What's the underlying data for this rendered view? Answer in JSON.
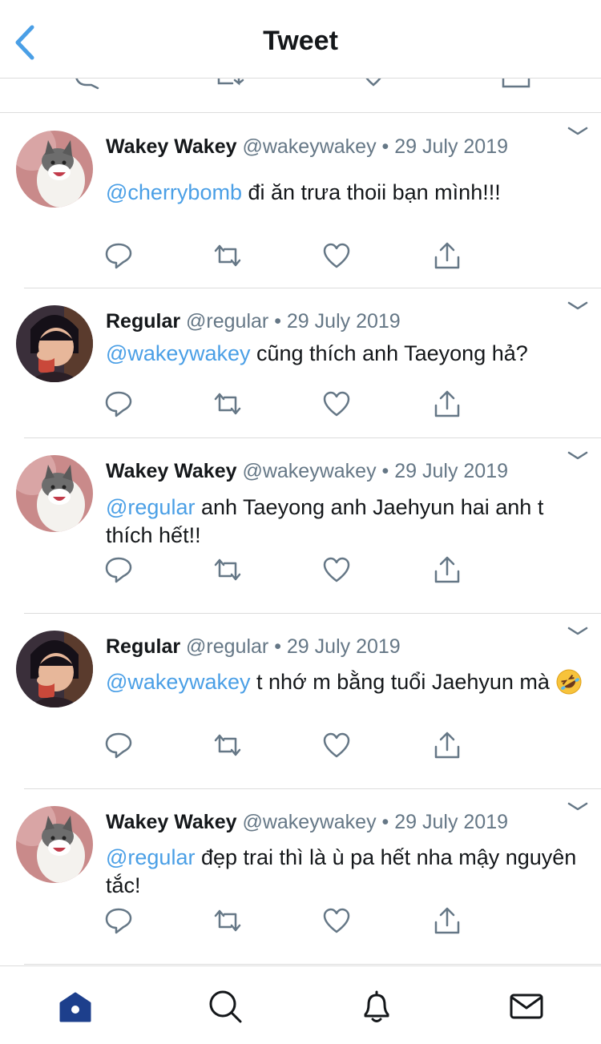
{
  "header": {
    "title": "Tweet",
    "back_icon": "chevron-left-icon"
  },
  "colors": {
    "accent": "#4a9fe6",
    "text": "#14171a",
    "muted": "#657786",
    "divider": "#dcdcdc",
    "home_active": "#1d3f8c"
  },
  "tweets": [
    {
      "name": "Wakey Wakey",
      "handle": "@wakeywakey",
      "dot": " • ",
      "date": "29 July 2019",
      "mention": "@cherrybomb",
      "text": " đi ăn trưa thoii bạn mình!!!",
      "avatar": "cat-avatar"
    },
    {
      "name": "Regular",
      "handle": "@regular",
      "dot": " • ",
      "date": "29 July 2019",
      "mention": "@wakeywakey",
      "text": " cũng thích anh Taeyong hả?",
      "avatar": "cartoon-girl-avatar"
    },
    {
      "name": "Wakey Wakey",
      "handle": "@wakeywakey",
      "dot": " • ",
      "date": "29 July 2019",
      "mention": "@regular",
      "text": " anh Taeyong anh Jaehyun hai anh t thích hết!!",
      "avatar": "cat-avatar"
    },
    {
      "name": "Regular",
      "handle": "@regular",
      "dot": " • ",
      "date": "29 July 2019",
      "mention": "@wakeywakey",
      "text": " t nhớ m bằng tuổi Jaehyun mà ",
      "emoji": "rolling-laughing-emoji",
      "avatar": "cartoon-girl-avatar"
    },
    {
      "name": "Wakey Wakey",
      "handle": "@wakeywakey",
      "dot": " • ",
      "date": "29 July 2019",
      "mention": "@regular",
      "text": " đẹp trai thì là ù pa hết nha mậy nguyên tắc!",
      "avatar": "cat-avatar"
    }
  ],
  "tweet_actions": [
    "reply-icon",
    "retweet-icon",
    "like-icon",
    "share-icon"
  ],
  "tabs": [
    "home-icon",
    "search-icon",
    "notifications-icon",
    "messages-icon"
  ]
}
